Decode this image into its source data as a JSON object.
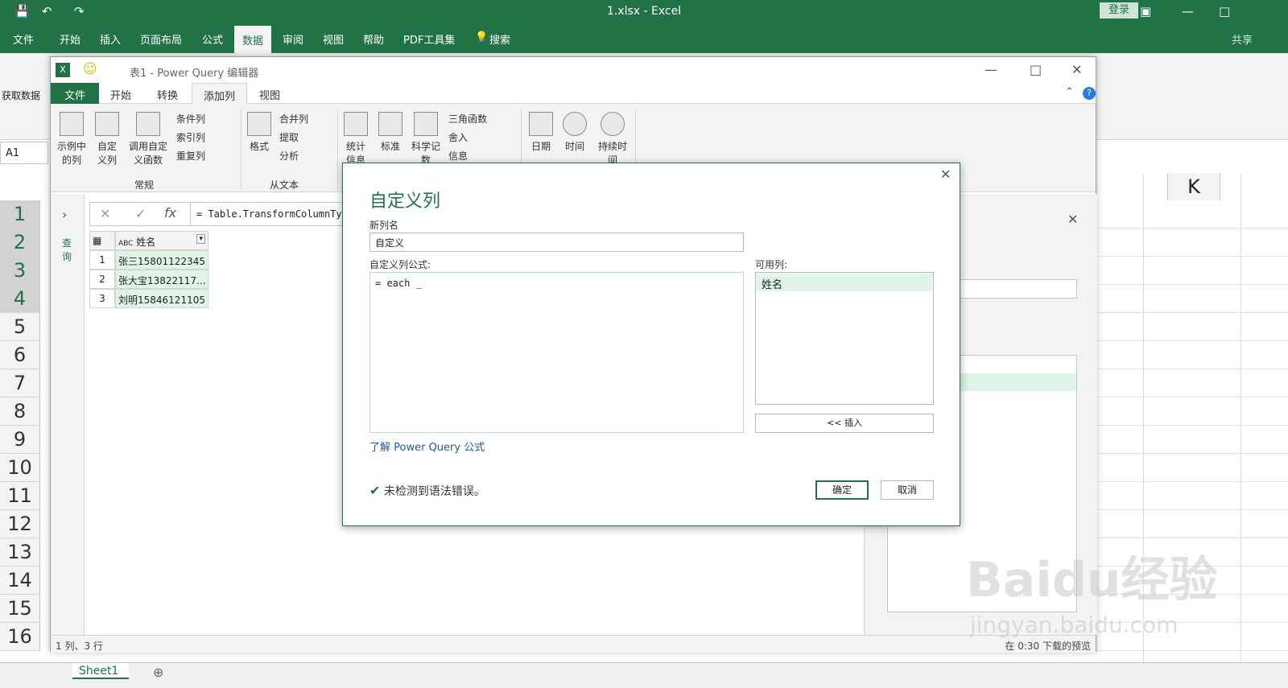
{
  "excel": {
    "file_title": "1.xlsx  -  Excel",
    "login": "登录",
    "tabs": [
      "文件",
      "开始",
      "插入",
      "页面布局",
      "公式",
      "数据",
      "审阅",
      "视图",
      "帮助",
      "PDF工具集",
      "搜索"
    ],
    "share": "共享",
    "ribbon_get_data": "获取数据",
    "namebox": "A1",
    "rows": [
      "1",
      "2",
      "3",
      "4",
      "5",
      "6",
      "7",
      "8",
      "9",
      "10",
      "11",
      "12",
      "13",
      "14",
      "15",
      "16"
    ],
    "col_k": "K",
    "sheet_tab": "Sheet1"
  },
  "pq": {
    "title": "表1 - Power Query 编辑器",
    "tabs": [
      "文件",
      "开始",
      "转换",
      "添加列",
      "视图"
    ],
    "ribbon": {
      "example_col": "示例中的列",
      "custom_col": "自定义列",
      "invoke_func": "调用自定义函数",
      "cond_col": "条件列",
      "index_col": "索引列",
      "dup_col": "重复列",
      "group_general": "常规",
      "format": "格式",
      "merge_col": "合并列",
      "extract": "提取",
      "parse": "分析",
      "group_text": "从文本",
      "stats": "统计信息",
      "standard": "标准",
      "scientific": "科学记数",
      "trig": "三角函数",
      "rounding": "舍入",
      "info": "信息",
      "date": "日期",
      "time": "时间",
      "duration": "持续时间"
    },
    "nav_label": "查询",
    "formula": "= Table.TransformColumnTy",
    "column_header": "姓名",
    "grid_rows": [
      {
        "n": "1",
        "v": "张三15801122345"
      },
      {
        "n": "2",
        "v": "张大宝13822117..."
      },
      {
        "n": "3",
        "v": "刘明15846121105"
      }
    ],
    "status_left": "1 列、3 行",
    "status_right": "在 0:30 下载的预览"
  },
  "dialog": {
    "title": "自定义列",
    "new_name_label": "新列名",
    "new_name_value": "自定义",
    "formula_label": "自定义列公式:",
    "formula_value": "= each  _",
    "available_label": "可用列:",
    "available_items": [
      "姓名"
    ],
    "insert_btn": "<< 插入",
    "learn_link": "了解 Power Query 公式",
    "status": "未检测到语法错误。",
    "ok": "确定",
    "cancel": "取消"
  },
  "watermark": {
    "brand": "Baidu经验",
    "url": "jingyan.baidu.com"
  }
}
